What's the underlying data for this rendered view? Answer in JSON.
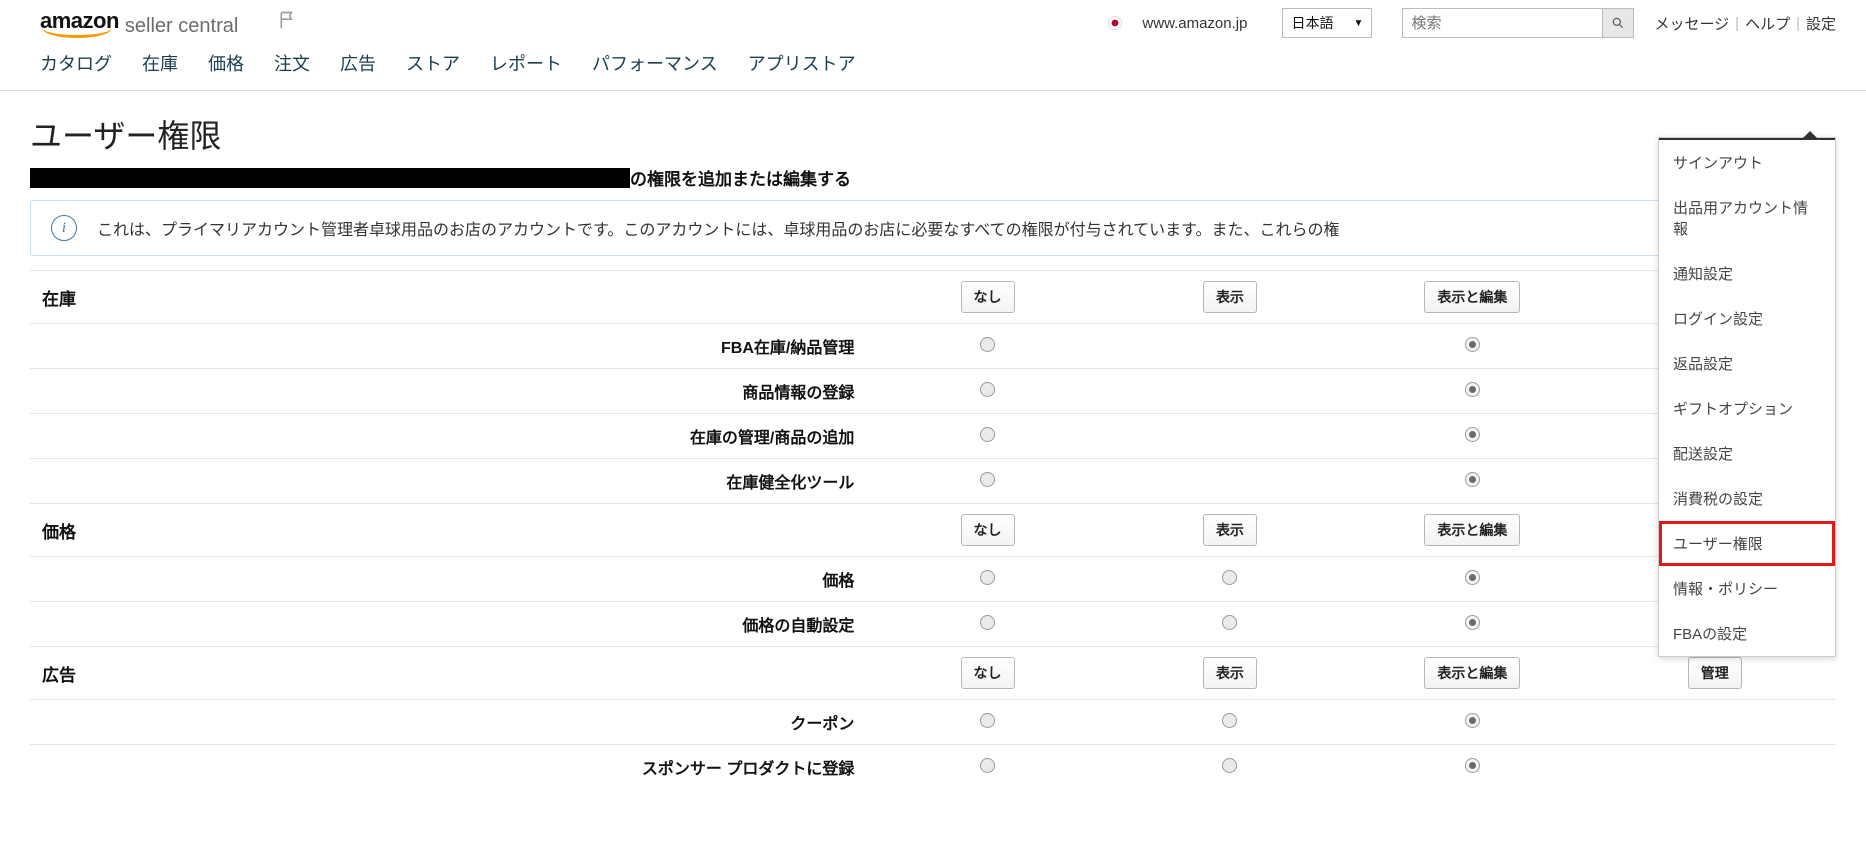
{
  "header": {
    "logo_word": "amazon",
    "logo_sub": "seller central",
    "marketplace": "www.amazon.jp",
    "language": "日本語",
    "search_placeholder": "検索",
    "links": {
      "messages": "メッセージ",
      "help": "ヘルプ",
      "settings": "設定"
    }
  },
  "nav": [
    "カタログ",
    "在庫",
    "価格",
    "注文",
    "広告",
    "ストア",
    "レポート",
    "パフォーマンス",
    "アプリストア"
  ],
  "page": {
    "title": "ユーザー権限",
    "subtitle_suffix": "の権限を追加または編集する",
    "info_text": "これは、プライマリアカウント管理者卓球用品のお店のアカウントです。このアカウントには、卓球用品のお店に必要なすべての権限が付与されています。また、これらの権"
  },
  "buttons": {
    "none": "なし",
    "view": "表示",
    "view_edit": "表示と編集",
    "admin": "管理"
  },
  "sections": [
    {
      "name": "在庫",
      "has_admin": false,
      "rows": [
        {
          "label": "FBA在庫/納品管理",
          "none": "disabled",
          "view": "empty",
          "edit": "checked",
          "admin": "empty"
        },
        {
          "label": "商品情報の登録",
          "none": "disabled",
          "view": "empty",
          "edit": "checked",
          "admin": "empty"
        },
        {
          "label": "在庫の管理/商品の追加",
          "none": "disabled",
          "view": "empty",
          "edit": "checked",
          "admin": "empty"
        },
        {
          "label": "在庫健全化ツール",
          "none": "disabled",
          "view": "empty",
          "edit": "checked",
          "admin": "empty"
        }
      ]
    },
    {
      "name": "価格",
      "has_admin": false,
      "rows": [
        {
          "label": "価格",
          "none": "disabled",
          "view": "disabled",
          "edit": "checked",
          "admin": "empty"
        },
        {
          "label": "価格の自動設定",
          "none": "disabled",
          "view": "disabled",
          "edit": "checked",
          "admin": "empty"
        }
      ]
    },
    {
      "name": "広告",
      "has_admin": true,
      "rows": [
        {
          "label": "クーポン",
          "none": "disabled",
          "view": "disabled",
          "edit": "checked",
          "admin": "empty"
        },
        {
          "label": "スポンサー プロダクトに登録",
          "none": "disabled",
          "view": "disabled",
          "edit": "checked",
          "admin": "empty"
        }
      ]
    }
  ],
  "settings_menu": [
    {
      "label": "サインアウト",
      "highlight": false
    },
    {
      "label": "出品用アカウント情報",
      "highlight": false
    },
    {
      "label": "通知設定",
      "highlight": false
    },
    {
      "label": "ログイン設定",
      "highlight": false
    },
    {
      "label": "返品設定",
      "highlight": false
    },
    {
      "label": "ギフトオプション",
      "highlight": false
    },
    {
      "label": "配送設定",
      "highlight": false
    },
    {
      "label": "消費税の設定",
      "highlight": false
    },
    {
      "label": "ユーザー権限",
      "highlight": true
    },
    {
      "label": "情報・ポリシー",
      "highlight": false
    },
    {
      "label": "FBAの設定",
      "highlight": false
    }
  ]
}
